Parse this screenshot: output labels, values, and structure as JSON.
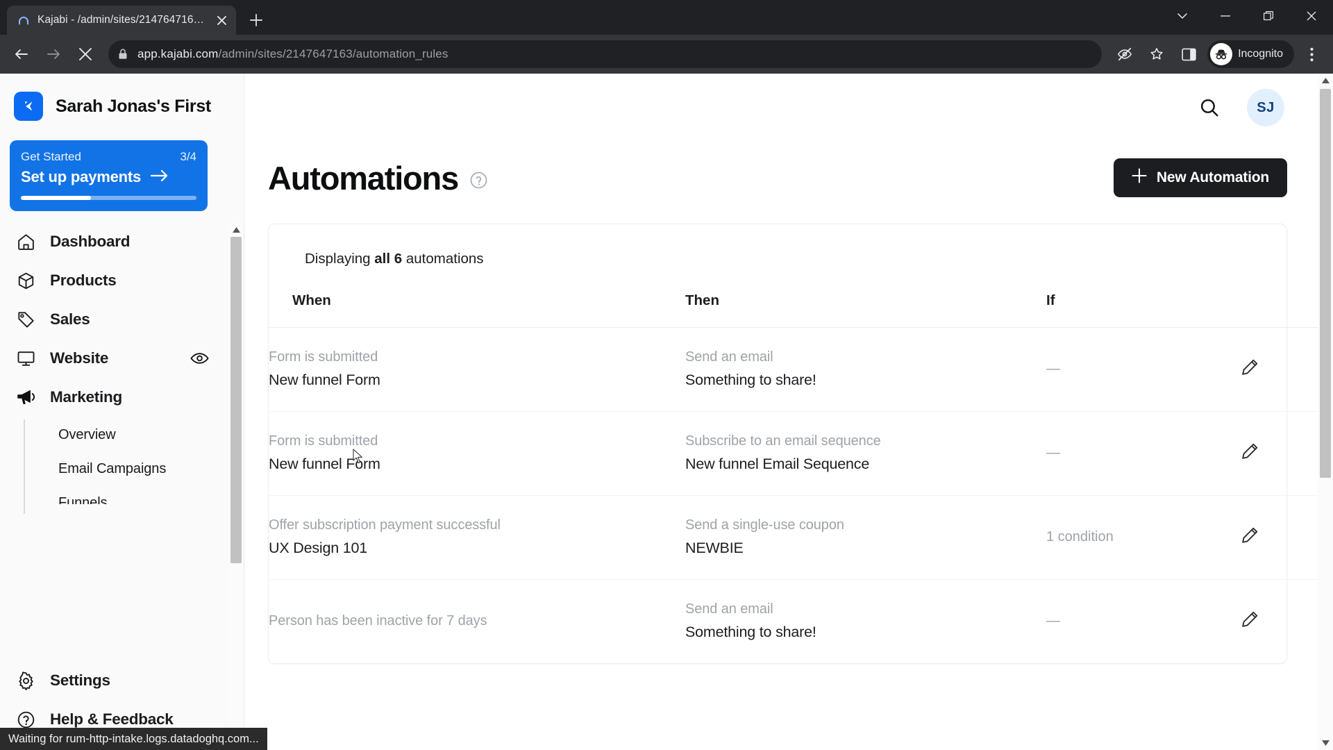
{
  "browser": {
    "tab": {
      "title": "Kajabi - /admin/sites/214764716…",
      "favicon_name": "kajabi-tab-favicon",
      "close_label": "×"
    },
    "new_tab_label": "+",
    "window_controls": {
      "tab_search": "tab-search",
      "minimize": "minimize",
      "maximize": "restore",
      "close": "close"
    },
    "toolbar": {
      "back": "back",
      "forward": "forward",
      "stop": "stop-loading",
      "url_host": "app.kajabi.com",
      "url_path": "/admin/sites/2147647163/automation_rules",
      "url_full": "app.kajabi.com/admin/sites/2147647163/automation_rules",
      "lock_icon": "site-secure-lock",
      "tracking_icon": "third-party-cookie-blocked",
      "bookmark_icon": "bookmark-star",
      "side_panel_icon": "side-panel",
      "incognito_label": "Incognito",
      "menu_icon": "chrome-menu"
    },
    "status_text": "Waiting for rum-http-intake.logs.datadoghq.com..."
  },
  "sidebar": {
    "brand_name": "Sarah Jonas's First",
    "get_started": {
      "label": "Get Started",
      "count": "3/4",
      "action": "Set up payments",
      "progress_percent": 40
    },
    "items": [
      {
        "label": "Dashboard",
        "icon": "home-icon"
      },
      {
        "label": "Products",
        "icon": "cube-icon"
      },
      {
        "label": "Sales",
        "icon": "tag-icon"
      },
      {
        "label": "Website",
        "icon": "monitor-icon",
        "trailing_icon": "eye-icon"
      },
      {
        "label": "Marketing",
        "icon": "megaphone-icon"
      }
    ],
    "marketing_subitems": [
      {
        "label": "Overview"
      },
      {
        "label": "Email Campaigns"
      },
      {
        "label": "Funnels"
      }
    ],
    "bottom_items": [
      {
        "label": "Settings",
        "icon": "gear-icon"
      },
      {
        "label": "Help & Feedback",
        "icon": "help-circle-icon"
      }
    ]
  },
  "topbar": {
    "search_icon": "search-icon",
    "avatar_initials": "SJ"
  },
  "page": {
    "title": "Automations",
    "help_icon": "help-circle-icon",
    "new_button": "New Automation",
    "new_button_icon": "plus-icon",
    "displaying_prefix": "Displaying ",
    "displaying_strong": "all 6",
    "displaying_suffix": " automations"
  },
  "table": {
    "columns": [
      "When",
      "Then",
      "If",
      ""
    ],
    "rows": [
      {
        "when_label": "Form is submitted",
        "when_value": "New funnel Form",
        "then_label": "Send an email",
        "then_value": "Something to share!",
        "if_value": "—",
        "action_icon": "edit-pencil-icon"
      },
      {
        "when_label": "Form is submitted",
        "when_value": "New funnel Form",
        "then_label": "Subscribe to an email sequence",
        "then_value": "New funnel Email Sequence",
        "if_value": "—",
        "action_icon": "edit-pencil-icon"
      },
      {
        "when_label": "Offer subscription payment successful",
        "when_value": "UX Design 101",
        "then_label": "Send a single-use coupon",
        "then_value": "NEWBIE",
        "if_value": "1 condition",
        "action_icon": "edit-pencil-icon"
      },
      {
        "when_label": "Person has been inactive for 7 days",
        "when_value": "",
        "then_label": "Send an email",
        "then_value": "Something to share!",
        "if_value": "—",
        "action_icon": "edit-pencil-icon"
      }
    ]
  },
  "colors": {
    "brand_blue": "#0b6bf2",
    "get_started_blue": "#1273e6",
    "button_dark": "#1c1d20",
    "avatar_bg": "#e2f0fd",
    "avatar_fg": "#12407f",
    "muted_text": "#9ea3a9"
  }
}
